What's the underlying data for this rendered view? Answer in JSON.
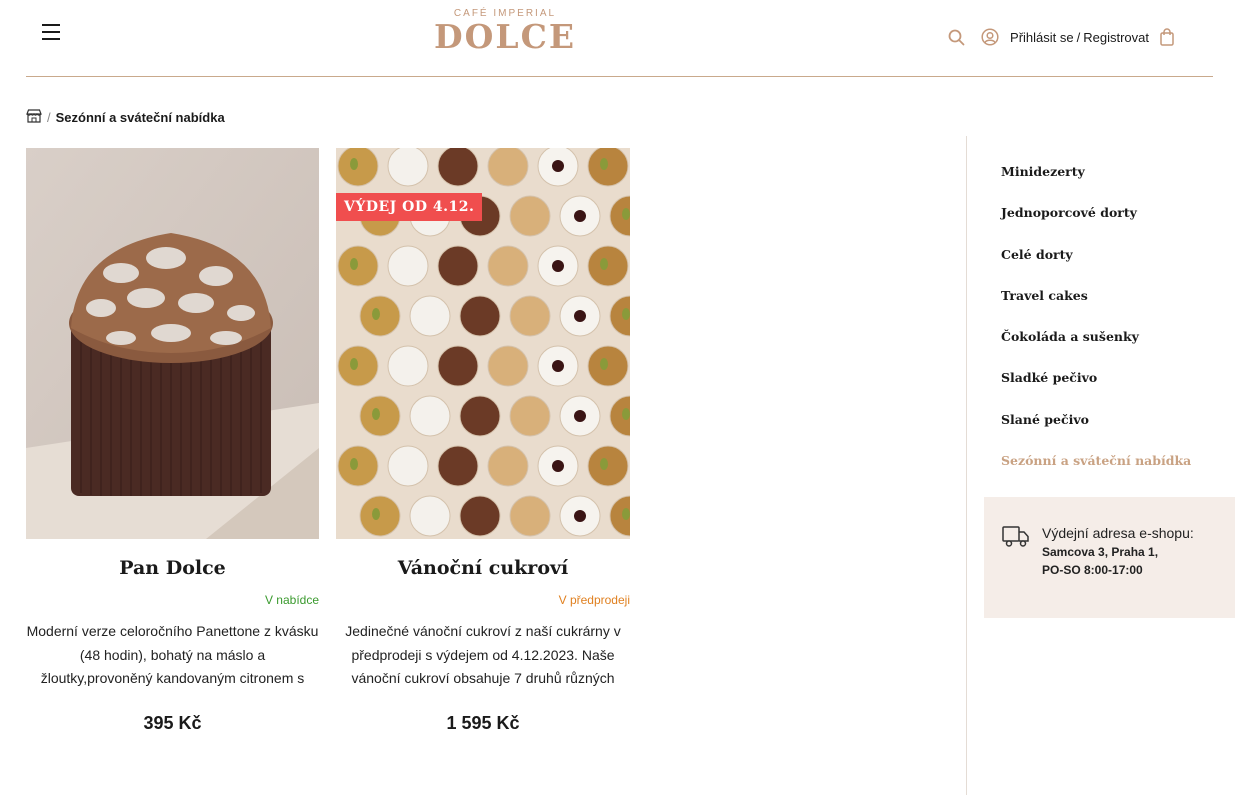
{
  "header": {
    "menu_icon": "hamburger-menu-icon",
    "logo_sub": "CAFÉ IMPERIAL",
    "logo_main": "DOLCE",
    "search_icon": "search-icon",
    "user_icon": "user-icon",
    "login_label": "Přihlásit se",
    "register_label": "Registrovat",
    "login_separator": "/",
    "cart_icon": "shopping-bag-icon",
    "accent_color": "#c4987a"
  },
  "breadcrumb": {
    "home_icon": "store-icon",
    "separator": "/",
    "current": "Sezónní a sváteční nabídka"
  },
  "products": [
    {
      "title": "Pan Dolce",
      "status": "V nabídce",
      "status_color": "#3a9a2e",
      "description": "Moderní verze celoročního Panettone z kvásku (48 hodin), bohatý na máslo a žloutky,provoněný kandovaným citronem s",
      "price": "395 Kč"
    },
    {
      "title": "Vánoční cukroví",
      "badge": "VÝDEJ OD 4.12.",
      "status": "V předprodeji",
      "status_color": "#e08020",
      "description": "Jedinečné vánoční cukroví z naší cukrárny v předprodeji s výdejem od 4.12.2023. Naše vánoční cukroví obsahuje 7 druhů různých",
      "price": "1 595 Kč"
    }
  ],
  "sidebar": {
    "items": [
      {
        "label": "Minidezerty"
      },
      {
        "label": "Jednoporcové dorty"
      },
      {
        "label": "Celé dorty"
      },
      {
        "label": "Travel cakes"
      },
      {
        "label": "Čokoláda a sušenky"
      },
      {
        "label": "Sladké pečivo"
      },
      {
        "label": "Slané pečivo"
      },
      {
        "label": "Sezónní a sváteční nabídka",
        "active": true
      }
    ],
    "pickup": {
      "icon": "truck-icon",
      "label": "Výdejní adresa e-shopu:",
      "address": "Samcova 3, Praha 1,",
      "hours": "PO-SO 8:00-17:00"
    }
  }
}
